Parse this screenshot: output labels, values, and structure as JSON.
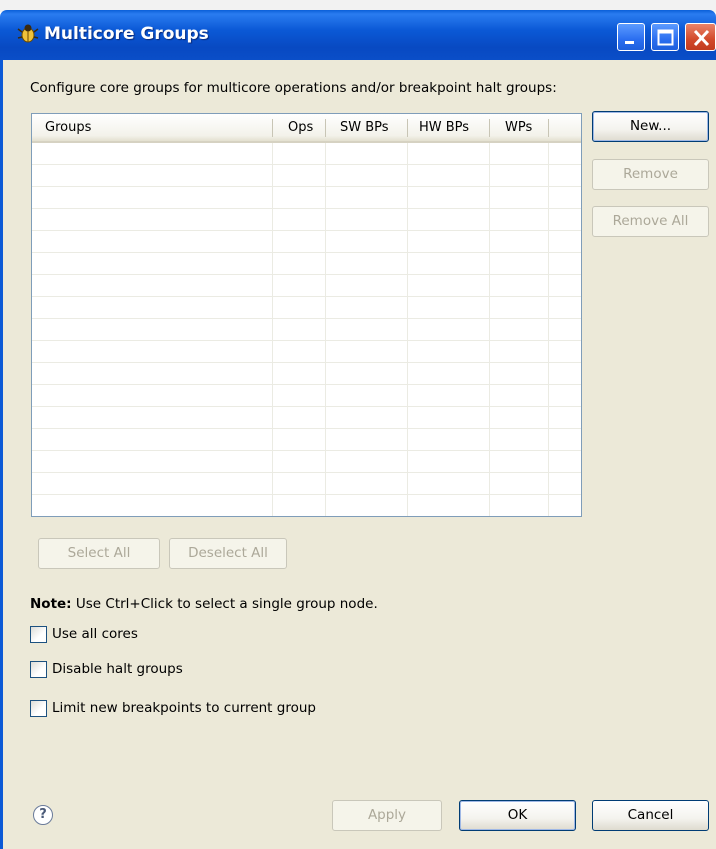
{
  "window": {
    "title": "Multicore Groups",
    "icon": "debug-bug-icon"
  },
  "dialog": {
    "intro": "Configure core groups for multicore operations and/or breakpoint halt groups:",
    "table": {
      "columns": [
        "Groups",
        "Ops",
        "SW BPs",
        "HW BPs",
        "WPs"
      ],
      "rows": []
    },
    "buttons": {
      "new": "New...",
      "remove": "Remove",
      "remove_all": "Remove All",
      "select_all": "Select All",
      "deselect_all": "Deselect All",
      "apply": "Apply",
      "ok": "OK",
      "cancel": "Cancel"
    },
    "note_bold": "Note:",
    "note_text": " Use Ctrl+Click to select a single group node.",
    "checkboxes": [
      {
        "label": "Use all cores",
        "checked": false
      },
      {
        "label": "Disable halt groups",
        "checked": false
      },
      {
        "label": "Limit new breakpoints to current group",
        "checked": false
      }
    ],
    "help_icon": "help-icon"
  },
  "colors": {
    "titlebar": "#0b59d6",
    "dialog_bg": "#ece9d8",
    "close_button": "#d2492a"
  }
}
